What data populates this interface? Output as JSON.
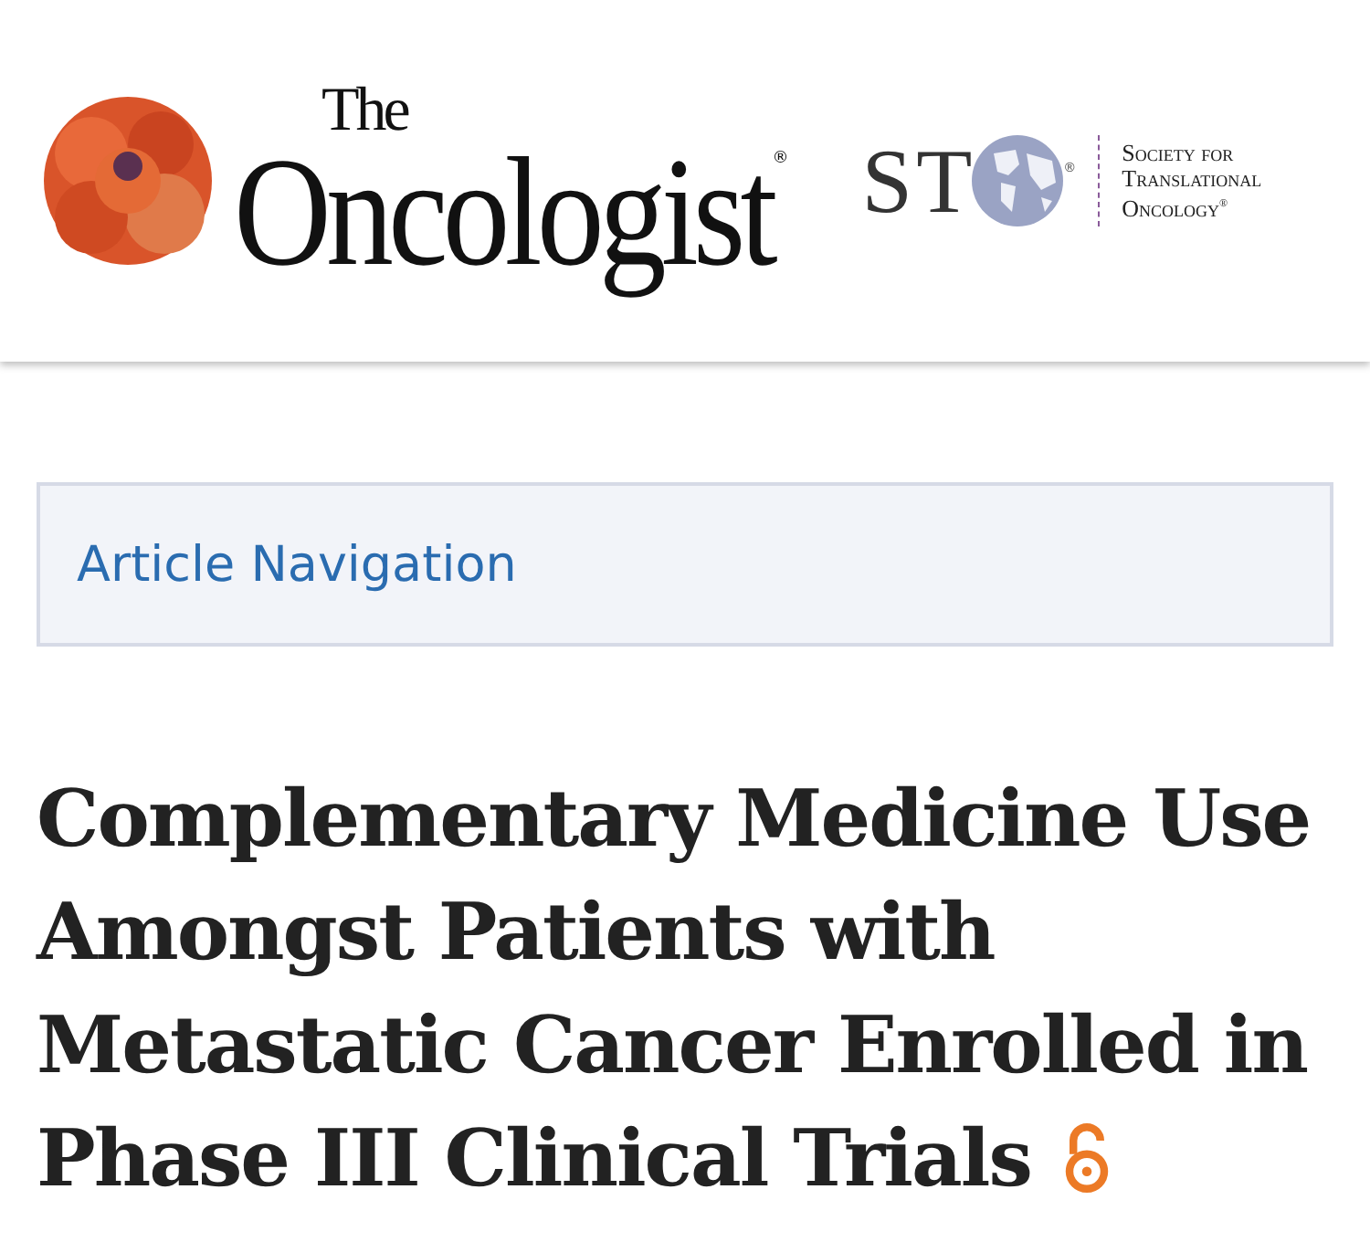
{
  "header": {
    "journal_logo": {
      "small": "The",
      "name": "Oncologist",
      "mark": "®"
    },
    "society_logo": {
      "letters": "ST",
      "mark": "®",
      "name": "Society for Translational Oncology$^{®}$"
    }
  },
  "article_navigation": {
    "label": "Article Navigation"
  },
  "article": {
    "title": "Complementary Medicine Use Amongst Patients with Metastatic Cancer Enrolled in Phase III Clinical Trials",
    "open_access": true
  }
}
